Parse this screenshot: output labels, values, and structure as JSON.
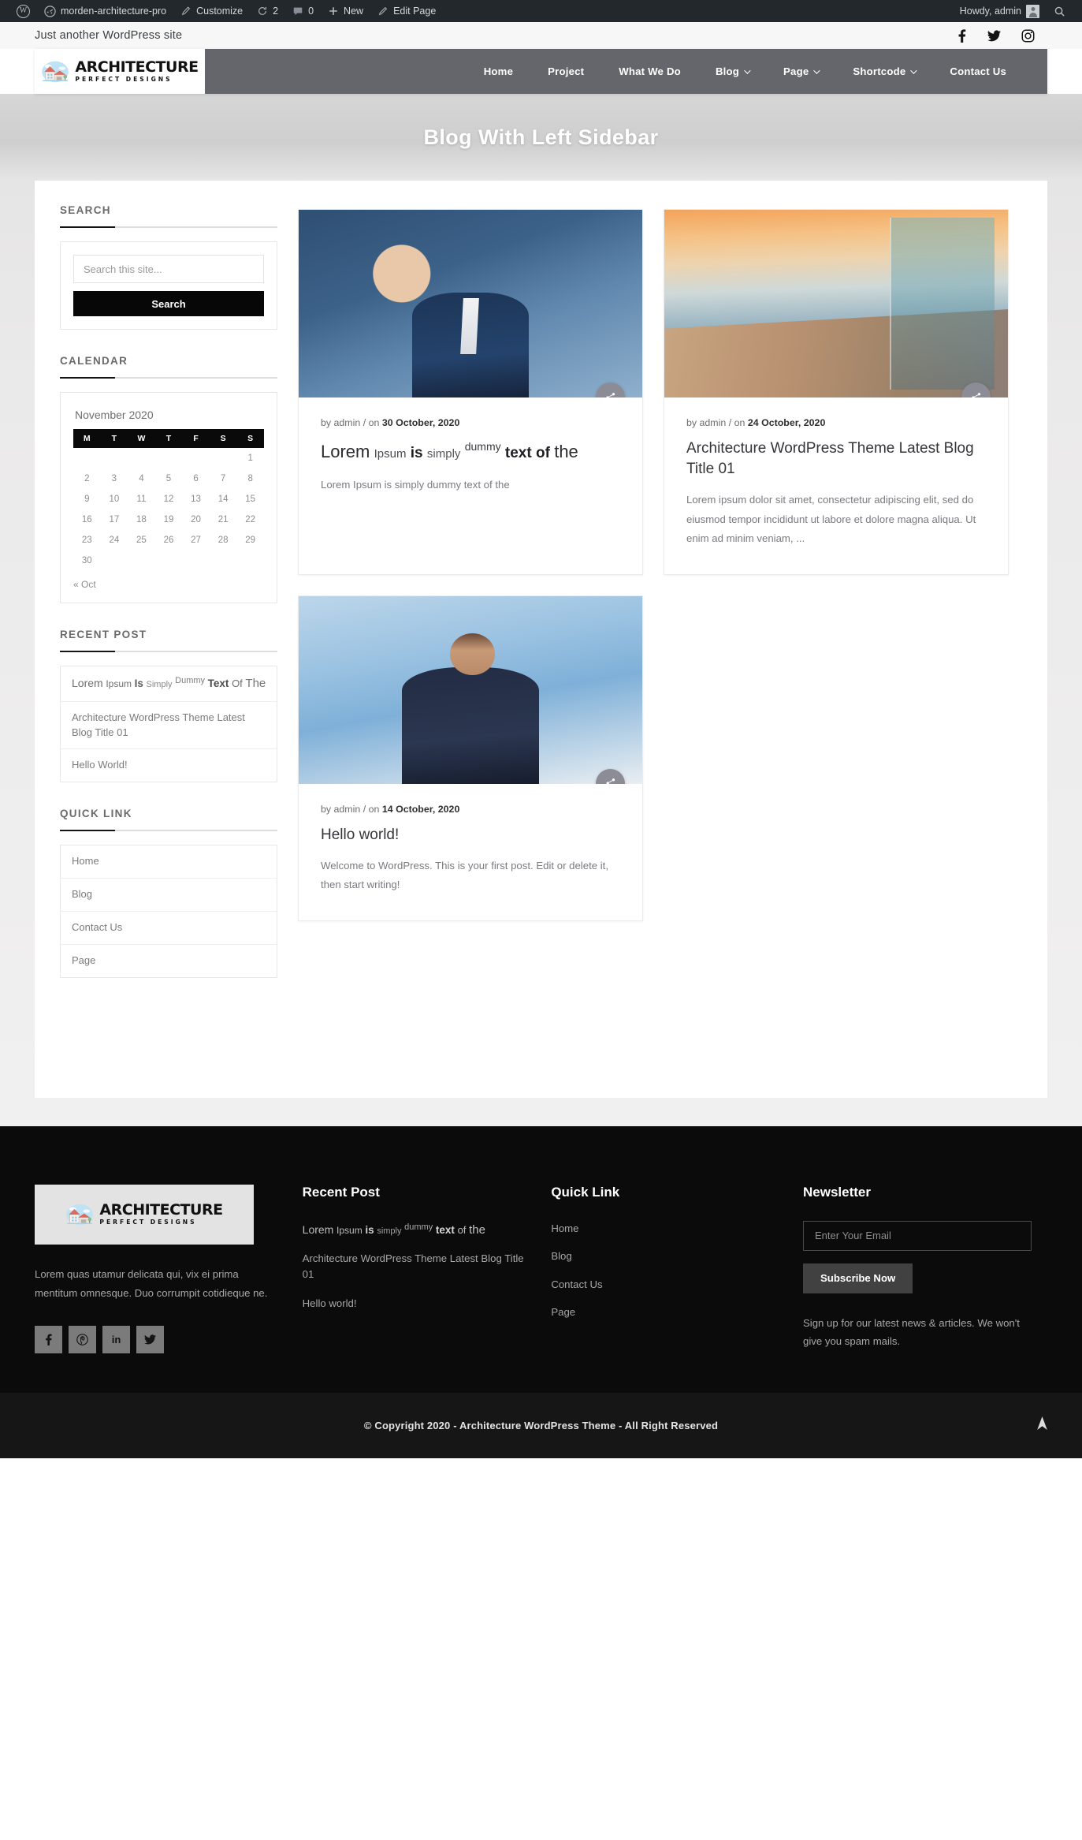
{
  "adminbar": {
    "wp_logo_icon": "wordpress-logo-icon",
    "site_name": "morden-architecture-pro",
    "site_icon": "dashboard-icon",
    "customize": "Customize",
    "customize_icon": "brush-icon",
    "updates_icon": "update-arrows-icon",
    "updates_count": "2",
    "comments_icon": "comment-bubble-icon",
    "comments_count": "0",
    "new_icon": "plus-icon",
    "new_label": "New",
    "edit_icon": "pencil-icon",
    "edit_label": "Edit Page",
    "howdy": "Howdy, admin",
    "avatar_icon": "user-avatar-icon",
    "search_icon": "search-icon"
  },
  "topbar": {
    "tagline": "Just another WordPress site",
    "social": [
      {
        "name": "facebook-icon",
        "glyph": "f"
      },
      {
        "name": "twitter-icon",
        "glyph": "🕊"
      },
      {
        "name": "instagram-icon",
        "glyph": "▢"
      }
    ]
  },
  "header": {
    "logo_title": "ARCHITECTURE",
    "logo_sub": "PERFECT DESIGNS",
    "logo_icon": "house-logo-icon",
    "nav": [
      {
        "label": "Home",
        "dropdown": false
      },
      {
        "label": "Project",
        "dropdown": false
      },
      {
        "label": "What We Do",
        "dropdown": false
      },
      {
        "label": "Blog",
        "dropdown": true
      },
      {
        "label": "Page",
        "dropdown": true
      },
      {
        "label": "Shortcode",
        "dropdown": true
      },
      {
        "label": "Contact Us",
        "dropdown": false
      }
    ]
  },
  "banner": {
    "title": "Blog With Left Sidebar"
  },
  "sidebar": {
    "search_widget": {
      "title": "SEARCH",
      "input_placeholder": "Search this site...",
      "input_value": "",
      "button_label": "Search"
    },
    "calendar_widget": {
      "title": "CALENDAR",
      "caption": "November 2020",
      "day_headers": [
        "M",
        "T",
        "W",
        "T",
        "F",
        "S",
        "S"
      ],
      "weeks": [
        [
          "",
          "",
          "",
          "",
          "",
          "",
          "1"
        ],
        [
          "2",
          "3",
          "4",
          "5",
          "6",
          "7",
          "8"
        ],
        [
          "9",
          "10",
          "11",
          "12",
          "13",
          "14",
          "15"
        ],
        [
          "16",
          "17",
          "18",
          "19",
          "20",
          "21",
          "22"
        ],
        [
          "23",
          "24",
          "25",
          "26",
          "27",
          "28",
          "29"
        ],
        [
          "30",
          "",
          "",
          "",
          "",
          "",
          ""
        ]
      ],
      "prev_label": "« Oct"
    },
    "recent_post_widget": {
      "title": "RECENT POST",
      "items_mixed": [
        [
          "Lorem",
          "Ipsum",
          "Is",
          "Simply",
          "Dummy",
          "Text",
          "Of",
          "The"
        ]
      ],
      "item_2": "Architecture WordPress Theme Latest Blog Title 01",
      "item_3": "Hello World!"
    },
    "quick_link_widget": {
      "title": "QUICK LINK",
      "items": [
        "Home",
        "Blog",
        "Contact Us",
        "Page"
      ]
    }
  },
  "posts": [
    {
      "thumb": "businessman-in-blue-suit-image",
      "share_icon": "share-icon",
      "meta_prefix": "by admin / on ",
      "meta_date": "30 October, 2020",
      "title_mixed": [
        "Lorem",
        "Ipsum",
        "is",
        "simply",
        "dummy",
        "text",
        "of",
        "the"
      ],
      "excerpt": "Lorem Ipsum is simply dummy text of the"
    },
    {
      "thumb": "sunset-boardwalk-image",
      "share_icon": "share-icon",
      "meta_prefix": "by admin / on ",
      "meta_date": "24 October, 2020",
      "title": "Architecture WordPress Theme Latest Blog Title 01",
      "excerpt": "Lorem ipsum dolor sit amet, consectetur adipiscing elit, sed do eiusmod tempor incididunt ut labore et dolore magna aliqua. Ut enim ad minim veniam, ..."
    },
    {
      "thumb": "businesswoman-in-sunglasses-image",
      "share_icon": "share-icon",
      "meta_prefix": "by admin / on ",
      "meta_date": "14 October, 2020",
      "title": "Hello world!",
      "excerpt": "Welcome to WordPress. This is your first post. Edit or delete it, then start writing!"
    }
  ],
  "footer": {
    "logo_title": "ARCHITECTURE",
    "logo_sub": "PERFECT DESIGNS",
    "logo_icon": "house-logo-icon",
    "about": "Lorem quas utamur delicata qui, vix ei prima mentitum omnesque. Duo corrumpit cotidieque ne.",
    "social": [
      {
        "name": "facebook-icon",
        "glyph": "f"
      },
      {
        "name": "pinterest-icon",
        "glyph": "Ⓟ"
      },
      {
        "name": "linkedin-icon",
        "glyph": "in"
      },
      {
        "name": "twitter-icon",
        "glyph": "🕊"
      }
    ],
    "recent_post": {
      "heading": "Recent Post",
      "item_1_mixed": [
        "Lorem",
        "Ipsum",
        "is",
        "simply",
        "dummy",
        "text",
        "of",
        "the"
      ],
      "item_2": "Architecture WordPress Theme Latest Blog Title 01",
      "item_3": "Hello world!"
    },
    "quick_link": {
      "heading": "Quick Link",
      "items": [
        "Home",
        "Blog",
        "Contact Us",
        "Page"
      ]
    },
    "newsletter": {
      "heading": "Newsletter",
      "input_placeholder": "Enter Your Email",
      "input_value": "",
      "button_label": "Subscribe Now",
      "note": "Sign up for our latest news & articles. We won't give you spam mails."
    },
    "copyright": "© Copyright 2020 - Architecture WordPress Theme - All Right Reserved",
    "to_top_icon": "scroll-to-top-icon"
  },
  "colors": {
    "adminbar_bg": "#23282d",
    "nav_bg": "#65666c",
    "accent_dark": "#0a0a0a",
    "footer_bg": "#0b0b0b",
    "copybar_bg": "#161616"
  }
}
